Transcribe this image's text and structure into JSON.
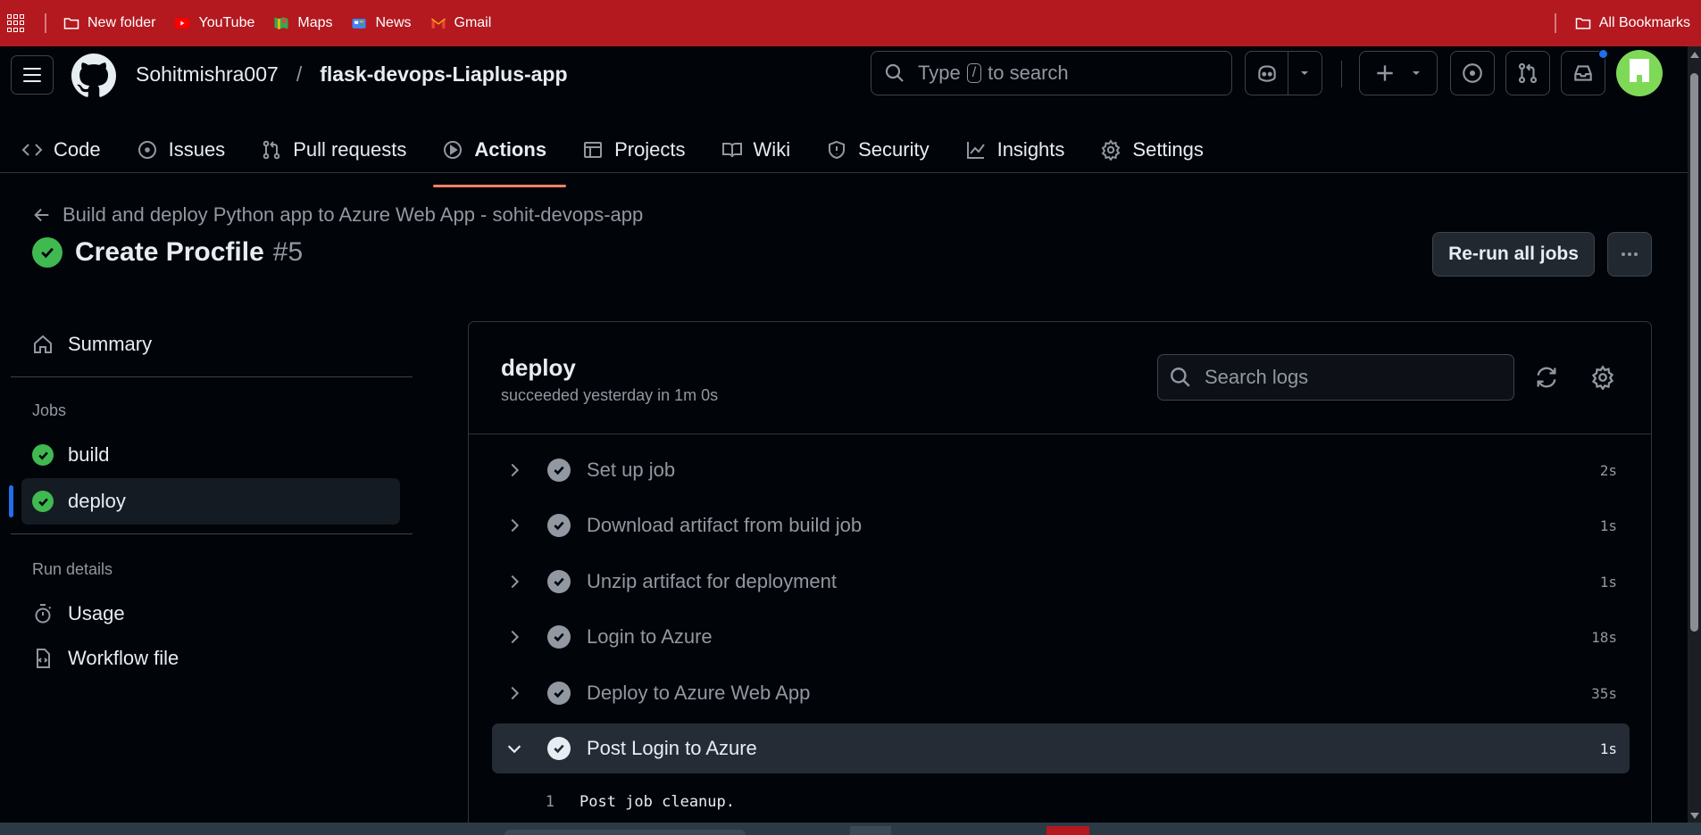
{
  "bookmarks": {
    "items": [
      {
        "label": "New folder",
        "icon": "folder-icon"
      },
      {
        "label": "YouTube",
        "icon": "youtube-icon"
      },
      {
        "label": "Maps",
        "icon": "maps-icon"
      },
      {
        "label": "News",
        "icon": "news-icon"
      },
      {
        "label": "Gmail",
        "icon": "gmail-icon"
      }
    ],
    "all_bookmarks": "All Bookmarks"
  },
  "header": {
    "owner": "Sohitmishra007",
    "separator": "/",
    "repo": "flask-devops-Liaplus-app",
    "search": {
      "prefix": "Type",
      "key": "/",
      "suffix": "to search"
    }
  },
  "repo_nav": {
    "tabs": [
      {
        "label": "Code",
        "icon": "code-icon"
      },
      {
        "label": "Issues",
        "icon": "issue-icon"
      },
      {
        "label": "Pull requests",
        "icon": "pull-request-icon"
      },
      {
        "label": "Actions",
        "icon": "play-icon",
        "active": true
      },
      {
        "label": "Projects",
        "icon": "table-icon"
      },
      {
        "label": "Wiki",
        "icon": "book-icon"
      },
      {
        "label": "Security",
        "icon": "shield-icon"
      },
      {
        "label": "Insights",
        "icon": "graph-icon"
      },
      {
        "label": "Settings",
        "icon": "gear-icon"
      }
    ]
  },
  "run": {
    "workflow_name": "Build and deploy Python app to Azure Web App - sohit-devops-app",
    "title": "Create Procfile",
    "number": "#5",
    "rerun_label": "Re-run all jobs"
  },
  "sidebar": {
    "summary": "Summary",
    "jobs_heading": "Jobs",
    "jobs": [
      {
        "label": "build",
        "status": "success"
      },
      {
        "label": "deploy",
        "status": "success",
        "selected": true
      }
    ],
    "run_details_heading": "Run details",
    "usage": "Usage",
    "workflow_file": "Workflow file"
  },
  "log": {
    "job_name": "deploy",
    "status": "succeeded yesterday in 1m 0s",
    "search_placeholder": "Search logs",
    "steps": [
      {
        "name": "Set up job",
        "duration": "2s"
      },
      {
        "name": "Download artifact from build job",
        "duration": "1s"
      },
      {
        "name": "Unzip artifact for deployment",
        "duration": "1s"
      },
      {
        "name": "Login to Azure",
        "duration": "18s"
      },
      {
        "name": "Deploy to Azure Web App",
        "duration": "35s"
      },
      {
        "name": "Post Login to Azure",
        "duration": "1s",
        "expanded": true
      }
    ],
    "lines": [
      {
        "number": "1",
        "text": "Post job cleanup."
      }
    ]
  },
  "colors": {
    "bookmark_bar": "#b3191f",
    "background": "#010409",
    "success": "#3fb950",
    "active_tab_underline": "#f78166",
    "accent": "#1f6feb"
  }
}
